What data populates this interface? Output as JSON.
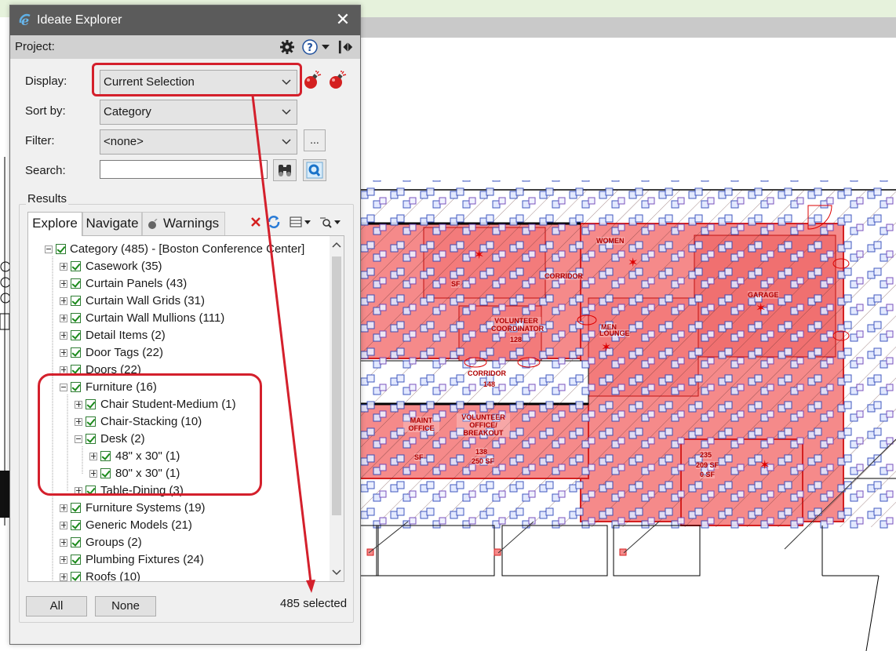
{
  "window": {
    "title": "Ideate Explorer"
  },
  "project": {
    "label": "Project:"
  },
  "display": {
    "label": "Display:",
    "value": "Current Selection"
  },
  "sort_by": {
    "label": "Sort by:",
    "value": "Category"
  },
  "filter": {
    "label": "Filter:",
    "value": "<none>",
    "more_label": "..."
  },
  "search": {
    "label": "Search:",
    "value": "",
    "placeholder": ""
  },
  "results": {
    "label": "Results"
  },
  "tabs": [
    {
      "label": "Explore",
      "active": true
    },
    {
      "label": "Navigate"
    },
    {
      "label": "Warnings"
    }
  ],
  "tree": {
    "root": "Category (485) - [Boston Conference Center]",
    "items": [
      "Casework (35)",
      "Curtain Panels (43)",
      "Curtain Wall Grids (31)",
      "Curtain Wall Mullions (111)",
      "Detail Items (2)",
      "Door Tags (22)",
      "Doors (22)",
      "Furniture (16)",
      "Chair Student-Medium (1)",
      "Chair-Stacking (10)",
      "Desk (2)",
      "48\" x 30\" (1)",
      "80\" x 30\" (1)",
      "Table-Dining (3)",
      "Furniture Systems (19)",
      "Generic Models (21)",
      "Groups (2)",
      "Plumbing Fixtures (24)",
      "Roofs (10)"
    ]
  },
  "footer": {
    "all_label": "All",
    "none_label": "None",
    "selected_count": "485 selected"
  },
  "plan_labels": [
    "CORRIDOR",
    "GARAGE",
    "CORRIDOR",
    "148",
    "MAINT OFFICE",
    "VOLUNTEER OFFICE/ BREAKOUT",
    "138",
    "250 SF",
    "235",
    "209 SF",
    "0 SF",
    "128",
    "WOMEN",
    "MEN",
    "LOUNGE",
    "VOLUNTEER COORDINATOR",
    "SF",
    "SF"
  ],
  "colors": {
    "titlebar": "#5b5b5b",
    "accent_red": "#d4202c",
    "plan_fill": "#f58a8a",
    "checkbox_green": "#1b8a1b"
  },
  "icons": {
    "app": "ideate-e-icon",
    "settings": "gear-icon",
    "help": "help-icon",
    "dock": "dock-panel-icon"
  }
}
